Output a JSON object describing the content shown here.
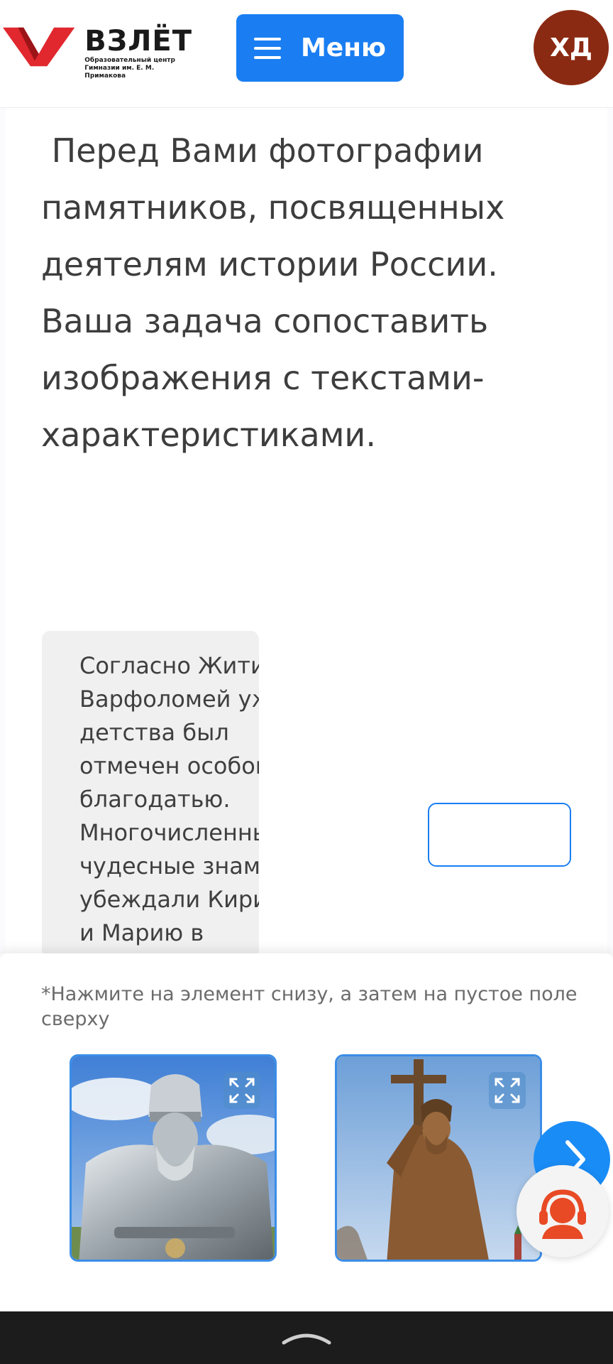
{
  "header": {
    "logo_title": "ВЗЛЁТ",
    "logo_subtitle_line1": "Образовательный центр",
    "logo_subtitle_line2": "Гимназии им. Е. М. Примакова",
    "menu_label": "Меню",
    "avatar_initials": "ХД",
    "colors": {
      "brand_red": "#e0282e",
      "menu_blue": "#1a7ef2",
      "avatar_brown": "#8b2a12"
    }
  },
  "main": {
    "intro_text": " Перед Вами фотографии памятников, посвященных деятелям истории России. Ваша задача сопоставить изображения с текстами-характеристиками.",
    "card_text": "Согласно Житию Варфоломей уже с детства был отмечен особой благодатью. Многочисленные чудесные знамения убеждали Кирилла и Марию в"
  },
  "answers": {
    "hint": "*Нажмите на элемент снизу, а затем на пустое поле сверху",
    "items": [
      {
        "icon": "expand-icon",
        "subject": "Genghis Khan statue"
      },
      {
        "icon": "expand-icon",
        "subject": "Vladimir the Great statue with cross"
      }
    ],
    "next_icon": "chevron-right-icon",
    "support_icon": "support-agent-icon"
  },
  "navbar": {
    "icon": "chevron-up-icon"
  }
}
